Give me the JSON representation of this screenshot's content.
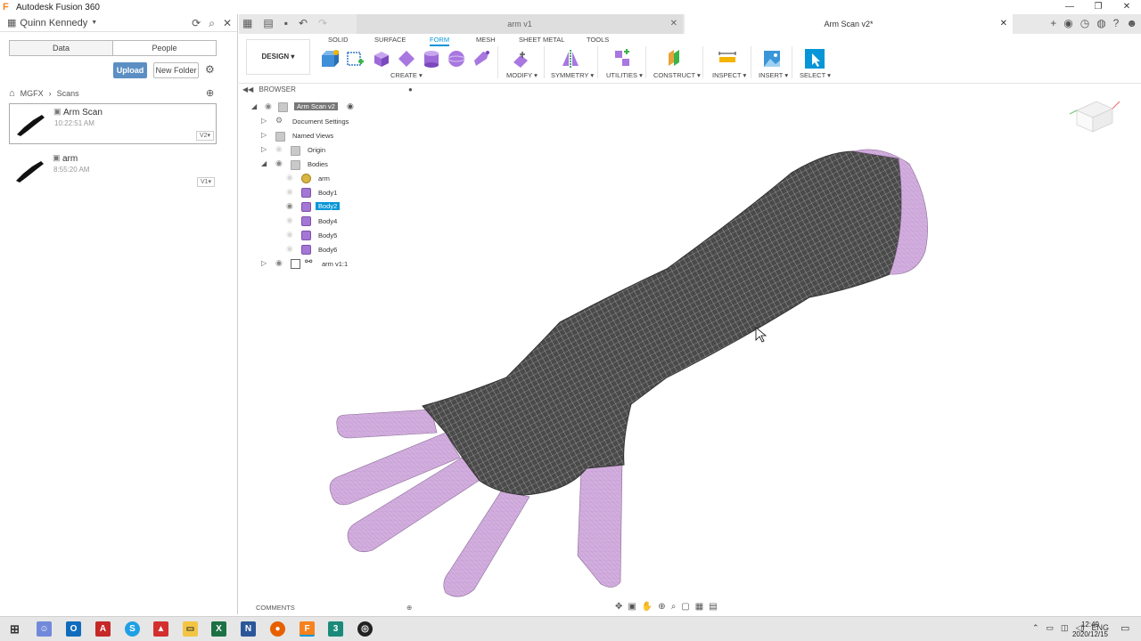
{
  "app": {
    "title": "Autodesk Fusion 360",
    "accent": "#0696d7"
  },
  "datapanel": {
    "user": "Quinn Kennedy",
    "tabs": [
      "Data",
      "People"
    ],
    "upload_label": "Upload",
    "new_folder_label": "New Folder",
    "breadcrumb": [
      "MGFX",
      "Scans"
    ],
    "files": [
      {
        "name": "Arm Scan",
        "time": "10:22:51 AM",
        "version": "V2▾"
      },
      {
        "name": "arm",
        "time": "8:55:20 AM",
        "version": "V1▾"
      }
    ]
  },
  "doctabs": {
    "inactive": "arm v1",
    "active": "Arm Scan v2*"
  },
  "toolbar": {
    "design_label": "DESIGN ▾",
    "workspaces": [
      "SOLID",
      "SURFACE",
      "FORM",
      "MESH",
      "SHEET METAL",
      "TOOLS"
    ],
    "active_workspace": "FORM",
    "groups": [
      "CREATE ▾",
      "MODIFY ▾",
      "SYMMETRY ▾",
      "UTILITIES ▾",
      "CONSTRUCT ▾",
      "INSPECT ▾",
      "INSERT ▾",
      "SELECT ▾"
    ]
  },
  "browser": {
    "title": "BROWSER",
    "root": "Arm Scan v2",
    "items": [
      "Document Settings",
      "Named Views",
      "Origin",
      "Bodies"
    ],
    "bodies": [
      "arm",
      "Body1",
      "Body2",
      "Body4",
      "Body5",
      "Body6"
    ],
    "link": "arm v1:1"
  },
  "bottom": {
    "comments": "COMMENTS"
  },
  "taskbar": {
    "lang": "ENG",
    "time": "12:49",
    "date": "2020/12/15",
    "notifications": "7"
  }
}
